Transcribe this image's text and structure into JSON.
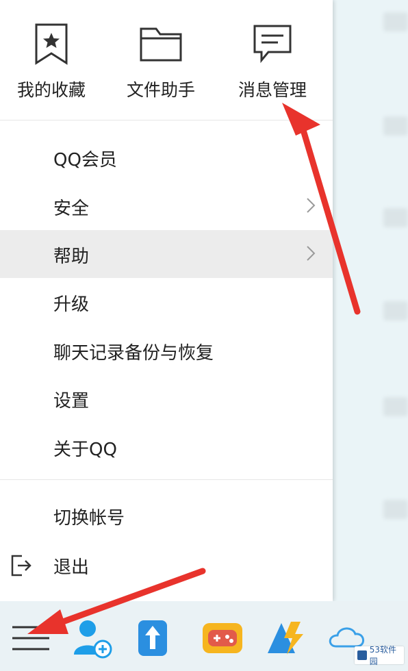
{
  "quick_actions": [
    {
      "label": "我的收藏",
      "icon": "star-bookmark-icon"
    },
    {
      "label": "文件助手",
      "icon": "folder-icon"
    },
    {
      "label": "消息管理",
      "icon": "message-icon"
    }
  ],
  "menu": {
    "items": [
      {
        "label": "QQ会员"
      },
      {
        "label": "安全",
        "has_submenu": true
      },
      {
        "label": "帮助",
        "has_submenu": true,
        "active": true
      },
      {
        "label": "升级"
      },
      {
        "label": "聊天记录备份与恢复"
      },
      {
        "label": "设置"
      },
      {
        "label": "关于QQ"
      },
      {
        "label": "切换帐号"
      },
      {
        "label": "退出",
        "icon": "exit-icon"
      }
    ]
  },
  "bottom_bar": {
    "icons": [
      "hamburger-menu-icon",
      "add-contact-icon",
      "file-transfer-icon",
      "game-icon",
      "lightning-app-icon",
      "cloud-icon"
    ]
  },
  "watermark": {
    "text": "53软件园"
  },
  "colors": {
    "accent_blue": "#1e9ee8",
    "annotation_red": "#e8332c",
    "active_row": "#ececec"
  }
}
